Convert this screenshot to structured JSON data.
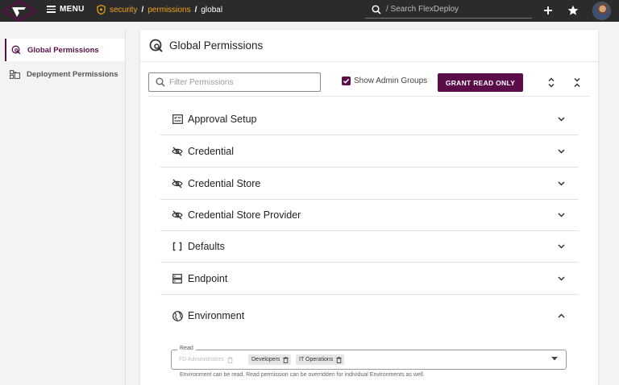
{
  "header": {
    "menu_label": "MENU",
    "breadcrumbs": [
      "security",
      "permissions",
      "global"
    ],
    "search_placeholder": "/ Search FlexDeploy"
  },
  "sidebar": {
    "items": [
      {
        "label": "Global Permissions",
        "icon": "shield-search-icon",
        "active": true
      },
      {
        "label": "Deployment Permissions",
        "icon": "deployment-grid-icon",
        "active": false
      }
    ]
  },
  "main": {
    "title": "Global Permissions",
    "filter_placeholder": "Filter Permissions",
    "show_admin_groups_label": "Show Admin Groups",
    "show_admin_groups_checked": true,
    "grant_button_label": "GRANT READ ONLY",
    "sections": [
      {
        "label": "Approval Setup",
        "icon": "approval-list-icon",
        "expanded": false
      },
      {
        "label": "Credential",
        "icon": "eye-off-icon",
        "expanded": false
      },
      {
        "label": "Credential Store",
        "icon": "eye-off-icon",
        "expanded": false
      },
      {
        "label": "Credential Store Provider",
        "icon": "eye-off-icon",
        "expanded": false
      },
      {
        "label": "Defaults",
        "icon": "brackets-icon",
        "expanded": false
      },
      {
        "label": "Endpoint",
        "icon": "server-icon",
        "expanded": false
      },
      {
        "label": "Environment",
        "icon": "globe-icon",
        "expanded": true
      }
    ],
    "environment": {
      "read_label": "Read",
      "chips": [
        {
          "label": "FD Administrators",
          "disabled": true
        },
        {
          "label": "Developers",
          "disabled": false
        },
        {
          "label": "IT Operations",
          "disabled": false
        }
      ],
      "hint": "Environment can be read. Read permission can be overridden for individual Environments as well."
    }
  },
  "colors": {
    "topbar": "#2b2b2b",
    "brand": "#5a0d49",
    "breadcrumb_link": "#f2a516",
    "background": "#f3f3f3"
  }
}
